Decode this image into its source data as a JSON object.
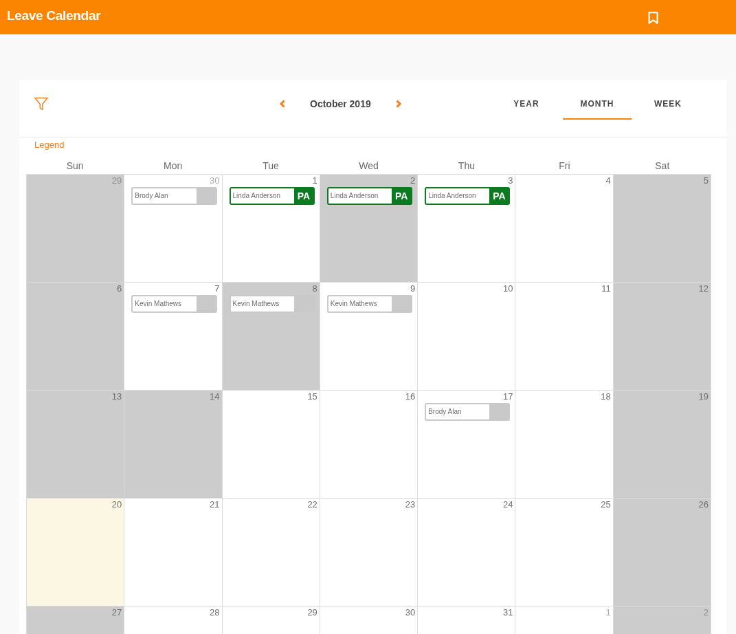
{
  "app_bar": {
    "title": "Leave Calendar"
  },
  "toolbar": {
    "period": "October 2019",
    "views": [
      {
        "label": "YEAR",
        "selected": false
      },
      {
        "label": "MONTH",
        "selected": true
      },
      {
        "label": "WEEK",
        "selected": false
      }
    ]
  },
  "legend": {
    "label": "Legend"
  },
  "calendar": {
    "weekdays": [
      "Sun",
      "Mon",
      "Tue",
      "Wed",
      "Thu",
      "Fri",
      "Sat"
    ],
    "weeks": [
      {
        "days": [
          {
            "day": "29",
            "outside_month": true,
            "off_day": true,
            "today": false
          },
          {
            "day": "30",
            "outside_month": true,
            "off_day": false,
            "today": false,
            "leaves": [
              {
                "name": "Brody Alan",
                "kind": "pending"
              }
            ]
          },
          {
            "day": "1",
            "outside_month": false,
            "off_day": false,
            "today": false,
            "leaves": [
              {
                "name": "Linda Anderson",
                "kind": "approved",
                "badge": "PA"
              }
            ]
          },
          {
            "day": "2",
            "outside_month": false,
            "off_day": true,
            "today": false,
            "leaves": [
              {
                "name": "Linda Anderson",
                "kind": "approved",
                "badge": "PA"
              }
            ]
          },
          {
            "day": "3",
            "outside_month": false,
            "off_day": false,
            "today": false,
            "leaves": [
              {
                "name": "Linda Anderson",
                "kind": "approved",
                "badge": "PA"
              }
            ]
          },
          {
            "day": "4",
            "outside_month": false,
            "off_day": false,
            "today": false
          },
          {
            "day": "5",
            "outside_month": false,
            "off_day": true,
            "today": false
          }
        ]
      },
      {
        "days": [
          {
            "day": "6",
            "outside_month": false,
            "off_day": true,
            "today": false
          },
          {
            "day": "7",
            "outside_month": false,
            "off_day": false,
            "today": false,
            "leaves": [
              {
                "name": "Kevin Mathews",
                "kind": "pending"
              }
            ]
          },
          {
            "day": "8",
            "outside_month": false,
            "off_day": true,
            "today": false,
            "leaves": [
              {
                "name": "Kevin Mathews",
                "kind": "pending"
              }
            ]
          },
          {
            "day": "9",
            "outside_month": false,
            "off_day": false,
            "today": false,
            "leaves": [
              {
                "name": "Kevin Mathews",
                "kind": "pending"
              }
            ]
          },
          {
            "day": "10",
            "outside_month": false,
            "off_day": false,
            "today": false
          },
          {
            "day": "11",
            "outside_month": false,
            "off_day": false,
            "today": false
          },
          {
            "day": "12",
            "outside_month": false,
            "off_day": true,
            "today": false
          }
        ]
      },
      {
        "days": [
          {
            "day": "13",
            "outside_month": false,
            "off_day": true,
            "today": false
          },
          {
            "day": "14",
            "outside_month": false,
            "off_day": true,
            "today": false
          },
          {
            "day": "15",
            "outside_month": false,
            "off_day": false,
            "today": false
          },
          {
            "day": "16",
            "outside_month": false,
            "off_day": false,
            "today": false
          },
          {
            "day": "17",
            "outside_month": false,
            "off_day": false,
            "today": false,
            "leaves": [
              {
                "name": "Brody Alan",
                "kind": "pending"
              }
            ]
          },
          {
            "day": "18",
            "outside_month": false,
            "off_day": false,
            "today": false
          },
          {
            "day": "19",
            "outside_month": false,
            "off_day": true,
            "today": false
          }
        ]
      },
      {
        "days": [
          {
            "day": "20",
            "outside_month": false,
            "off_day": false,
            "today": true
          },
          {
            "day": "21",
            "outside_month": false,
            "off_day": false,
            "today": false
          },
          {
            "day": "22",
            "outside_month": false,
            "off_day": false,
            "today": false
          },
          {
            "day": "23",
            "outside_month": false,
            "off_day": false,
            "today": false
          },
          {
            "day": "24",
            "outside_month": false,
            "off_day": false,
            "today": false
          },
          {
            "day": "25",
            "outside_month": false,
            "off_day": false,
            "today": false
          },
          {
            "day": "26",
            "outside_month": false,
            "off_day": true,
            "today": false
          }
        ]
      },
      {
        "days": [
          {
            "day": "27",
            "outside_month": false,
            "off_day": true,
            "today": false
          },
          {
            "day": "28",
            "outside_month": false,
            "off_day": false,
            "today": false
          },
          {
            "day": "29",
            "outside_month": false,
            "off_day": false,
            "today": false
          },
          {
            "day": "30",
            "outside_month": false,
            "off_day": false,
            "today": false
          },
          {
            "day": "31",
            "outside_month": false,
            "off_day": false,
            "today": false
          },
          {
            "day": "1",
            "outside_month": true,
            "off_day": false,
            "today": false
          },
          {
            "day": "2",
            "outside_month": true,
            "off_day": true,
            "today": false
          }
        ]
      }
    ]
  }
}
